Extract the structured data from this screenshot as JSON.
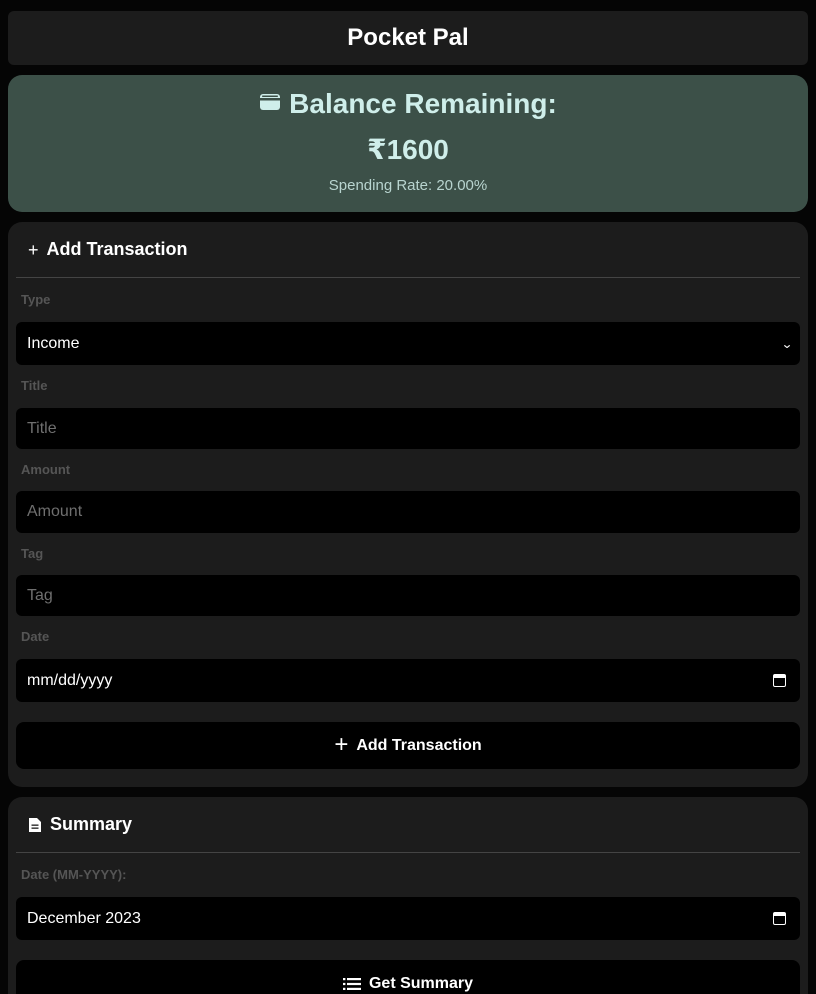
{
  "app": {
    "title": "Pocket Pal"
  },
  "balance": {
    "title": "Balance Remaining:",
    "amount": "₹1600",
    "spending_rate": "Spending Rate: 20.00%",
    "icon": "wallet-icon"
  },
  "add_transaction": {
    "header": "Add Transaction",
    "header_icon": "+",
    "fields": {
      "type": {
        "label": "Type",
        "value": "Income"
      },
      "title": {
        "label": "Title",
        "placeholder": "Title"
      },
      "amount": {
        "label": "Amount",
        "placeholder": "Amount"
      },
      "tag": {
        "label": "Tag",
        "placeholder": "Tag"
      },
      "date": {
        "label": "Date",
        "value": "mm/dd/yyyy"
      }
    },
    "submit_label": "Add Transaction",
    "submit_icon": "+"
  },
  "summary": {
    "header": "Summary",
    "date_label": "Date (MM-YYYY):",
    "date_value": "December 2023",
    "button_label": "Get Summary"
  },
  "colors": {
    "background": "#050505",
    "card": "#1c1c1c",
    "balance_card": "#3c5048",
    "balance_text": "#cfeeea",
    "input": "#000000"
  }
}
